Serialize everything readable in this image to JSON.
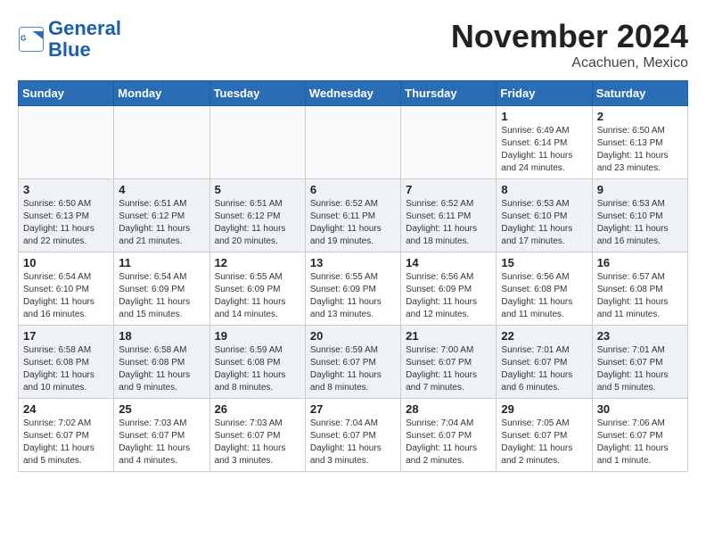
{
  "header": {
    "logo_line1": "General",
    "logo_line2": "Blue",
    "month_title": "November 2024",
    "location": "Acachuen, Mexico"
  },
  "weekdays": [
    "Sunday",
    "Monday",
    "Tuesday",
    "Wednesday",
    "Thursday",
    "Friday",
    "Saturday"
  ],
  "weeks": [
    {
      "row_class": "row-normal",
      "days": [
        {
          "number": "",
          "info": "",
          "empty": true
        },
        {
          "number": "",
          "info": "",
          "empty": true
        },
        {
          "number": "",
          "info": "",
          "empty": true
        },
        {
          "number": "",
          "info": "",
          "empty": true
        },
        {
          "number": "",
          "info": "",
          "empty": true
        },
        {
          "number": "1",
          "info": "Sunrise: 6:49 AM\nSunset: 6:14 PM\nDaylight: 11 hours\nand 24 minutes.",
          "empty": false
        },
        {
          "number": "2",
          "info": "Sunrise: 6:50 AM\nSunset: 6:13 PM\nDaylight: 11 hours\nand 23 minutes.",
          "empty": false
        }
      ]
    },
    {
      "row_class": "row-alt",
      "days": [
        {
          "number": "3",
          "info": "Sunrise: 6:50 AM\nSunset: 6:13 PM\nDaylight: 11 hours\nand 22 minutes.",
          "empty": false
        },
        {
          "number": "4",
          "info": "Sunrise: 6:51 AM\nSunset: 6:12 PM\nDaylight: 11 hours\nand 21 minutes.",
          "empty": false
        },
        {
          "number": "5",
          "info": "Sunrise: 6:51 AM\nSunset: 6:12 PM\nDaylight: 11 hours\nand 20 minutes.",
          "empty": false
        },
        {
          "number": "6",
          "info": "Sunrise: 6:52 AM\nSunset: 6:11 PM\nDaylight: 11 hours\nand 19 minutes.",
          "empty": false
        },
        {
          "number": "7",
          "info": "Sunrise: 6:52 AM\nSunset: 6:11 PM\nDaylight: 11 hours\nand 18 minutes.",
          "empty": false
        },
        {
          "number": "8",
          "info": "Sunrise: 6:53 AM\nSunset: 6:10 PM\nDaylight: 11 hours\nand 17 minutes.",
          "empty": false
        },
        {
          "number": "9",
          "info": "Sunrise: 6:53 AM\nSunset: 6:10 PM\nDaylight: 11 hours\nand 16 minutes.",
          "empty": false
        }
      ]
    },
    {
      "row_class": "row-normal",
      "days": [
        {
          "number": "10",
          "info": "Sunrise: 6:54 AM\nSunset: 6:10 PM\nDaylight: 11 hours\nand 16 minutes.",
          "empty": false
        },
        {
          "number": "11",
          "info": "Sunrise: 6:54 AM\nSunset: 6:09 PM\nDaylight: 11 hours\nand 15 minutes.",
          "empty": false
        },
        {
          "number": "12",
          "info": "Sunrise: 6:55 AM\nSunset: 6:09 PM\nDaylight: 11 hours\nand 14 minutes.",
          "empty": false
        },
        {
          "number": "13",
          "info": "Sunrise: 6:55 AM\nSunset: 6:09 PM\nDaylight: 11 hours\nand 13 minutes.",
          "empty": false
        },
        {
          "number": "14",
          "info": "Sunrise: 6:56 AM\nSunset: 6:09 PM\nDaylight: 11 hours\nand 12 minutes.",
          "empty": false
        },
        {
          "number": "15",
          "info": "Sunrise: 6:56 AM\nSunset: 6:08 PM\nDaylight: 11 hours\nand 11 minutes.",
          "empty": false
        },
        {
          "number": "16",
          "info": "Sunrise: 6:57 AM\nSunset: 6:08 PM\nDaylight: 11 hours\nand 11 minutes.",
          "empty": false
        }
      ]
    },
    {
      "row_class": "row-alt",
      "days": [
        {
          "number": "17",
          "info": "Sunrise: 6:58 AM\nSunset: 6:08 PM\nDaylight: 11 hours\nand 10 minutes.",
          "empty": false
        },
        {
          "number": "18",
          "info": "Sunrise: 6:58 AM\nSunset: 6:08 PM\nDaylight: 11 hours\nand 9 minutes.",
          "empty": false
        },
        {
          "number": "19",
          "info": "Sunrise: 6:59 AM\nSunset: 6:08 PM\nDaylight: 11 hours\nand 8 minutes.",
          "empty": false
        },
        {
          "number": "20",
          "info": "Sunrise: 6:59 AM\nSunset: 6:07 PM\nDaylight: 11 hours\nand 8 minutes.",
          "empty": false
        },
        {
          "number": "21",
          "info": "Sunrise: 7:00 AM\nSunset: 6:07 PM\nDaylight: 11 hours\nand 7 minutes.",
          "empty": false
        },
        {
          "number": "22",
          "info": "Sunrise: 7:01 AM\nSunset: 6:07 PM\nDaylight: 11 hours\nand 6 minutes.",
          "empty": false
        },
        {
          "number": "23",
          "info": "Sunrise: 7:01 AM\nSunset: 6:07 PM\nDaylight: 11 hours\nand 5 minutes.",
          "empty": false
        }
      ]
    },
    {
      "row_class": "row-normal",
      "days": [
        {
          "number": "24",
          "info": "Sunrise: 7:02 AM\nSunset: 6:07 PM\nDaylight: 11 hours\nand 5 minutes.",
          "empty": false
        },
        {
          "number": "25",
          "info": "Sunrise: 7:03 AM\nSunset: 6:07 PM\nDaylight: 11 hours\nand 4 minutes.",
          "empty": false
        },
        {
          "number": "26",
          "info": "Sunrise: 7:03 AM\nSunset: 6:07 PM\nDaylight: 11 hours\nand 3 minutes.",
          "empty": false
        },
        {
          "number": "27",
          "info": "Sunrise: 7:04 AM\nSunset: 6:07 PM\nDaylight: 11 hours\nand 3 minutes.",
          "empty": false
        },
        {
          "number": "28",
          "info": "Sunrise: 7:04 AM\nSunset: 6:07 PM\nDaylight: 11 hours\nand 2 minutes.",
          "empty": false
        },
        {
          "number": "29",
          "info": "Sunrise: 7:05 AM\nSunset: 6:07 PM\nDaylight: 11 hours\nand 2 minutes.",
          "empty": false
        },
        {
          "number": "30",
          "info": "Sunrise: 7:06 AM\nSunset: 6:07 PM\nDaylight: 11 hours\nand 1 minute.",
          "empty": false
        }
      ]
    }
  ]
}
